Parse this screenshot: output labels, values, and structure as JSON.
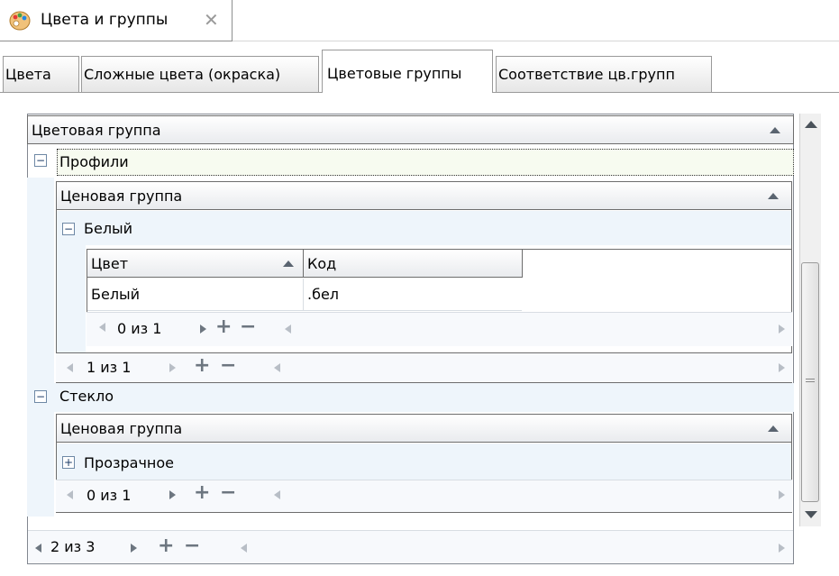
{
  "doc_tab": {
    "title": "Цвета и группы",
    "close": "✕",
    "icon": "palette-icon"
  },
  "tabs": [
    "Цвета",
    "Сложные цвета (окраска)",
    "Цветовые группы",
    "Соответствие цв.групп"
  ],
  "grid": {
    "header": "Цветовая группа",
    "groups": [
      {
        "name": "Профили",
        "sub_header": "Ценовая группа",
        "items": [
          {
            "name": "Белый",
            "columns": [
              "Цвет",
              "Код"
            ],
            "rows": [
              [
                "Белый",
                ".бел"
              ]
            ],
            "nav": "0 из 1"
          }
        ],
        "nav": "1 из 1"
      },
      {
        "name": "Стекло",
        "sub_header": "Ценовая группа",
        "items": [
          {
            "name": "Прозрачное"
          }
        ],
        "nav": "0 из 1"
      }
    ],
    "nav": "2 из 3"
  },
  "glyphs": {
    "minus": "−",
    "plus": "+",
    "expand": "+",
    "collapse": "−"
  },
  "colors": {
    "accent": "#6d6d6d",
    "row_bg": "#eef5fb",
    "border": "#828790"
  }
}
